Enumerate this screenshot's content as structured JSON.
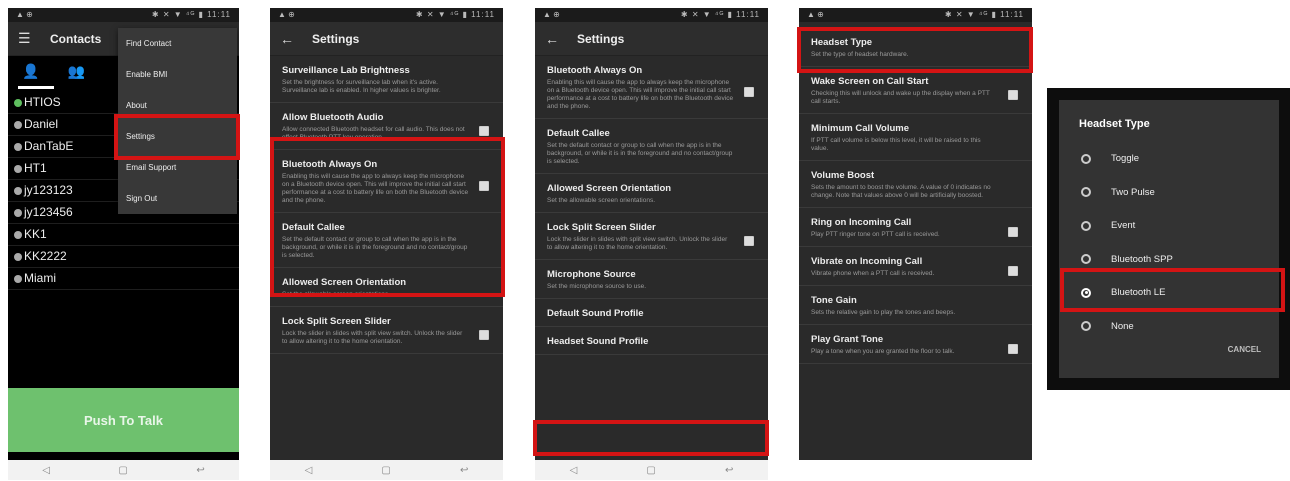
{
  "status": {
    "left": "▲ ⊕",
    "right": "✱ ✕ ▼ ⁴ᴳ ▮ 11:11"
  },
  "nav": {
    "back": "◁",
    "home": "▢",
    "recent": "↩"
  },
  "phone1": {
    "menu_icon": "☰",
    "title": "Contacts",
    "tab_person": "👤",
    "tab_group": "👥",
    "contacts": [
      {
        "name": "HTIOS",
        "color": "#5fbf5f"
      },
      {
        "name": "Daniel",
        "color": "#aaaaaa"
      },
      {
        "name": "DanTabE",
        "color": "#aaaaaa"
      },
      {
        "name": "HT1",
        "color": "#aaaaaa"
      },
      {
        "name": "jy123123",
        "color": "#aaaaaa"
      },
      {
        "name": "jy123456",
        "color": "#aaaaaa"
      },
      {
        "name": "KK1",
        "color": "#aaaaaa"
      },
      {
        "name": "KK2222",
        "color": "#aaaaaa"
      },
      {
        "name": "Miami",
        "color": "#aaaaaa"
      }
    ],
    "menu": [
      "Find Contact",
      "Enable BMI",
      "About",
      "Settings",
      "Email Support",
      "Sign Out"
    ],
    "ptt_label": "Push To Talk"
  },
  "phone2": {
    "back_icon": "←",
    "title": "Settings",
    "prefs": [
      {
        "title": "Surveillance Lab Brightness",
        "summary": "Set the brightness for surveillance lab when it's active. Surveillance lab is enabled. In higher values is brighter."
      },
      {
        "title": "Allow Bluetooth Audio",
        "summary": "Allow connected Bluetooth headset for call audio. This does not effect Bluetooth PTT key operation."
      },
      {
        "title": "Bluetooth Always On",
        "summary": "Enabling this will cause the app to always keep the microphone on a Bluetooth device open. This will improve the initial call start performance at a cost to battery life on both the Bluetooth device and the phone."
      },
      {
        "title": "Default Callee",
        "summary": "Set the default contact or group to call when the app is in the background, or while it is in the foreground and no contact/group is selected."
      },
      {
        "title": "Allowed Screen Orientation",
        "summary": "Set the allowable screen orientations."
      },
      {
        "title": "Lock Split Screen Slider",
        "summary": "Lock the slider in slides with split view switch. Unlock the slider to allow altering it to the home orientation."
      }
    ]
  },
  "phone3": {
    "back_icon": "←",
    "title": "Settings",
    "prefs": [
      {
        "title": "Bluetooth Always On",
        "summary": "Enabling this will cause the app to always keep the microphone on a Bluetooth device open. This will improve the initial call start performance at a cost to battery life on both the Bluetooth device and the phone."
      },
      {
        "title": "Default Callee",
        "summary": "Set the default contact or group to call when the app is in the background, or while it is in the foreground and no contact/group is selected."
      },
      {
        "title": "Allowed Screen Orientation",
        "summary": "Set the allowable screen orientations."
      },
      {
        "title": "Lock Split Screen Slider",
        "summary": "Lock the slider in slides with split view switch. Unlock the slider to allow altering it to the home orientation."
      },
      {
        "title": "Microphone Source",
        "summary": "Set the microphone source to use."
      },
      {
        "title": "Default Sound Profile",
        "summary": ""
      },
      {
        "title": "Headset Sound Profile",
        "summary": ""
      }
    ]
  },
  "phone4": {
    "prefs": [
      {
        "title": "Headset Type",
        "summary": "Set the type of headset hardware."
      },
      {
        "title": "Wake Screen on Call Start",
        "summary": "Checking this will unlock and wake up the display when a PTT call starts."
      },
      {
        "title": "Minimum Call Volume",
        "summary": "If PTT call volume is below this level, it will be raised to this value."
      },
      {
        "title": "Volume Boost",
        "summary": "Sets the amount to boost the volume. A value of 0 indicates no change. Note that values above 0 will be artificially boosted."
      },
      {
        "title": "Ring on Incoming Call",
        "summary": "Play PTT ringer tone on PTT call is received."
      },
      {
        "title": "Vibrate on Incoming Call",
        "summary": "Vibrate phone when a PTT call is received."
      },
      {
        "title": "Tone Gain",
        "summary": "Sets the relative gain to play the tones and beeps."
      },
      {
        "title": "Play Grant Tone",
        "summary": "Play a tone when you are granted the floor to talk."
      }
    ]
  },
  "dialog": {
    "title": "Headset Type",
    "options": [
      "Toggle",
      "Two Pulse",
      "Event",
      "Bluetooth SPP",
      "Bluetooth LE",
      "None"
    ],
    "selected_index": 4,
    "cancel": "CANCEL"
  },
  "colors": {
    "highlight": "#d41414",
    "ptt_green": "#6ec16e"
  }
}
